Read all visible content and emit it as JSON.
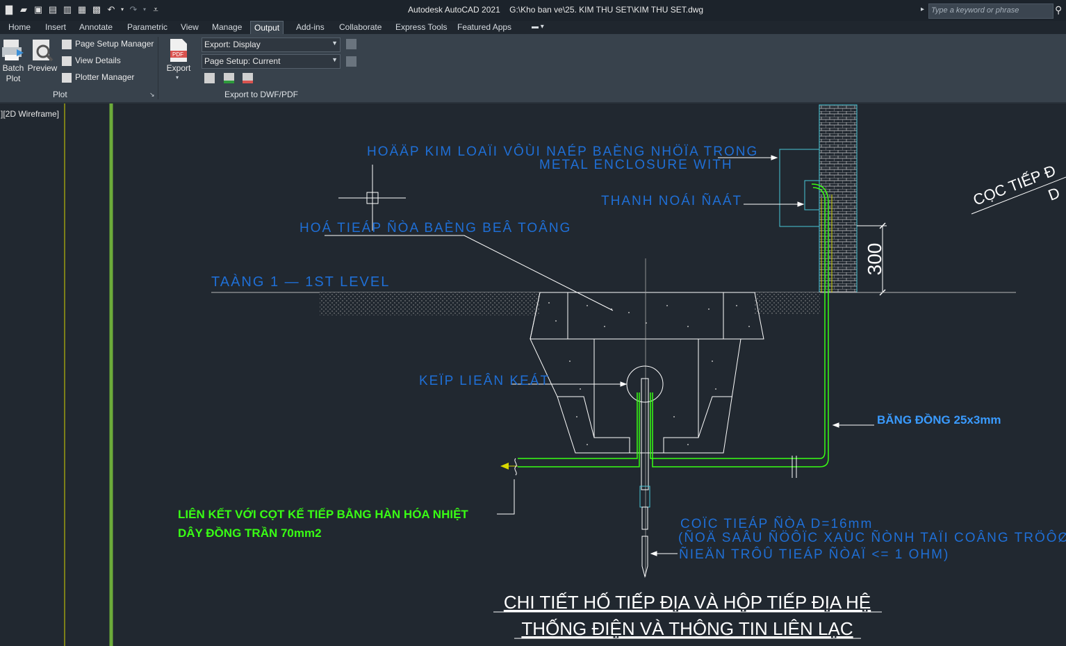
{
  "titlebar": {
    "app": "Autodesk AutoCAD 2021",
    "file": "G:\\Kho ban ve\\25. KIM THU SET\\KIM THU SET.dwg",
    "search_placeholder": "Type a keyword or phrase",
    "qat_icons": [
      "new-icon",
      "open-icon",
      "save-icon",
      "save-as-icon",
      "open-web-icon",
      "save-web-icon",
      "plot-icon",
      "undo-icon",
      "redo-icon",
      "customize-icon"
    ]
  },
  "tabs": [
    "Home",
    "Insert",
    "Annotate",
    "Parametric",
    "View",
    "Manage",
    "Output",
    "Add-ins",
    "Collaborate",
    "Express Tools",
    "Featured Apps"
  ],
  "active_tab": "Output",
  "ribbon": {
    "batch_plot": "Batch Plot",
    "batch_plot_l1": "Batch",
    "batch_plot_l2": "Plot",
    "preview": "Preview",
    "page_setup_manager": "Page Setup Manager",
    "view_details": "View Details",
    "plotter_manager": "Plotter Manager",
    "plot_panel": "Plot",
    "export": "Export",
    "export_dropdown": "Export: Display",
    "page_setup_dropdown": "Page Setup: Current",
    "export_panel": "Export to DWF/PDF"
  },
  "viewport": {
    "label": "][2D Wireframe]"
  },
  "drawing": {
    "enclosure_l1": "HOÄÄP KIM LOAÏI VÔÙI NAÉP BAÈNG NHÖÏA TRONG",
    "enclosure_l2": "METAL ENCLOSURE WITH",
    "terminal": "THANH NOÁI ÑAÁT",
    "pit_cover": "HOÁ TIEÁP ÑÒA BAÈNG BEÂ TOÂNG",
    "level": "TAÀNG 1 — 1ST LEVEL",
    "clamp": "KEÏP LIEÂN KEÁT",
    "copper_strip": "BĂNG ĐỒNG 25x3mm",
    "dim_300": "300",
    "link_l1": "LIÊN KẾT VỚI CỌT KẾ TIẾP BẰNG HÀN HÓA NHIỆT",
    "link_l2": "DÂY ĐỒNG TRẦN 70mm2",
    "rod_l1": "COÏC TIEÁP ÑÒA D=16mm",
    "rod_l2": "(ÑOÄ SAÂU ÑÖÔÏC XAÙC ÑÒNH TAÏI COÂNG TRÖÔØNG",
    "rod_l3": "ÑIEÄN TRÔÛ TIEÁP ÑÒAÏ <= 1 OHM)",
    "right_l1": "CỌC TIẾP Đ",
    "right_l2": "D",
    "heading_l1": "CHI TIẾT HỐ TIẾP ĐỊA VÀ HỘP TIẾP ĐỊA HỆ",
    "heading_l2": "THỐNG ĐIỆN VÀ THÔNG TIN LIÊN LẠC"
  },
  "colors": {
    "cad_blue": "#1f6fd6",
    "cad_bright_blue": "#3a9bff",
    "cad_green": "#39ff14",
    "cad_white": "#ffffff",
    "cad_cyan": "#49c7d8",
    "bg": "#212830"
  }
}
